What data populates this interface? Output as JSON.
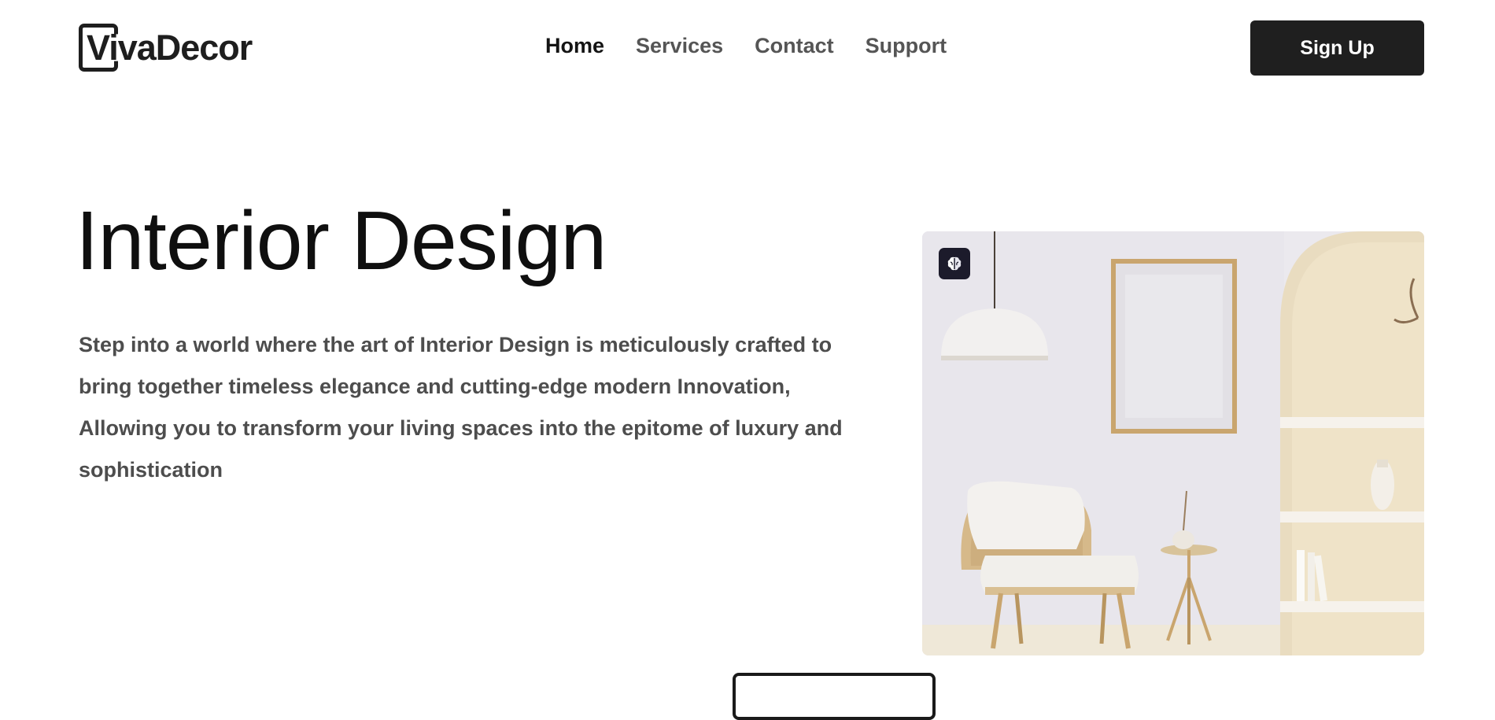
{
  "brand": {
    "name": "VivaDecor"
  },
  "nav": {
    "items": [
      {
        "label": "Home",
        "active": true
      },
      {
        "label": "Services",
        "active": false
      },
      {
        "label": "Contact",
        "active": false
      },
      {
        "label": "Support",
        "active": false
      }
    ]
  },
  "header": {
    "signup_label": "Sign Up"
  },
  "hero": {
    "title": "Interior Design",
    "description": "Step into a world where the art of Interior Design is meticulously crafted to bring together timeless elegance and cutting-edge modern Innovation, Allowing you to transform your living spaces into the epitome of luxury and sophistication"
  },
  "media": {
    "badge_icon": "brain-icon",
    "image_icon": "living-room-photo"
  },
  "colors": {
    "primary": "#1f1f1f",
    "nav_text": "#555555",
    "body_text": "#4d4d4d",
    "badge_bg": "#1c1b2b"
  }
}
